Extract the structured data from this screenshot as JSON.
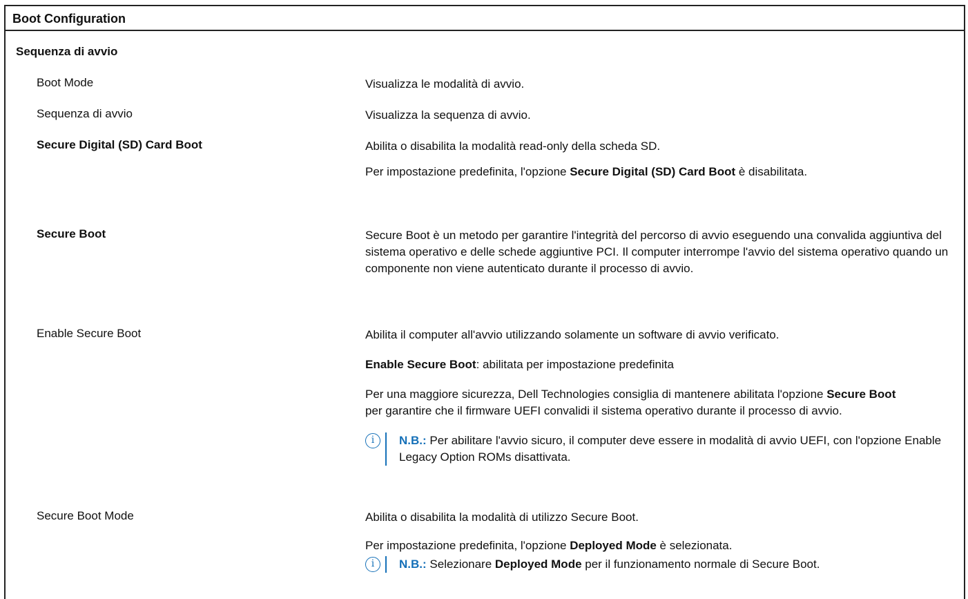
{
  "header": {
    "title": "Boot Configuration"
  },
  "rows": {
    "section": {
      "label": "Sequenza di avvio"
    },
    "boot_mode": {
      "label": "Boot Mode",
      "desc": "Visualizza le modalità di avvio."
    },
    "boot_sequence": {
      "label": "Sequenza di avvio",
      "desc": "Visualizza la sequenza di avvio."
    },
    "sd_boot": {
      "label": "Secure Digital (SD) Card Boot",
      "desc": "Abilita o disabilita la modalità read-only della scheda SD.",
      "default_pre": "Per impostazione predefinita, l'opzione ",
      "default_bold": "Secure Digital (SD) Card Boot",
      "default_post": " è disabilitata."
    },
    "secure_boot": {
      "label": "Secure Boot",
      "desc": "Secure Boot è un metodo per garantire l'integrità del percorso di avvio eseguendo una convalida aggiuntiva del sistema operativo e delle schede aggiuntive PCI. Il computer interrompe l'avvio del sistema operativo quando un componente non viene autenticato durante il processo di avvio."
    },
    "enable_secure_boot": {
      "label": "Enable Secure Boot",
      "desc": "Abilita il computer all'avvio utilizzando solamente un software di avvio verificato.",
      "default_bold": "Enable Secure Boot",
      "default_post": ": abilitata per impostazione predefinita",
      "rec_pre": "Per una maggiore sicurezza, Dell Technologies consiglia di mantenere abilitata l'opzione ",
      "rec_bold": "Secure Boot",
      "rec_post": " per garantire che il firmware UEFI convalidi il sistema operativo durante il processo di avvio.",
      "note_label": "N.B.:",
      "note_text": " Per abilitare l'avvio sicuro, il computer deve essere in modalità di avvio UEFI, con l'opzione Enable Legacy Option ROMs disattivata."
    },
    "secure_boot_mode": {
      "label": "Secure Boot Mode",
      "desc": "Abilita o disabilita la modalità di utilizzo Secure Boot.",
      "default_pre": "Per impostazione predefinita, l'opzione ",
      "default_bold": "Deployed Mode",
      "default_post": " è selezionata.",
      "note_label": "N.B.:",
      "note_pre": " Selezionare ",
      "note_bold": "Deployed Mode",
      "note_post": " per il funzionamento normale di Secure Boot."
    }
  },
  "icons": {
    "info": "info-icon",
    "info_color": "#1570b8"
  }
}
